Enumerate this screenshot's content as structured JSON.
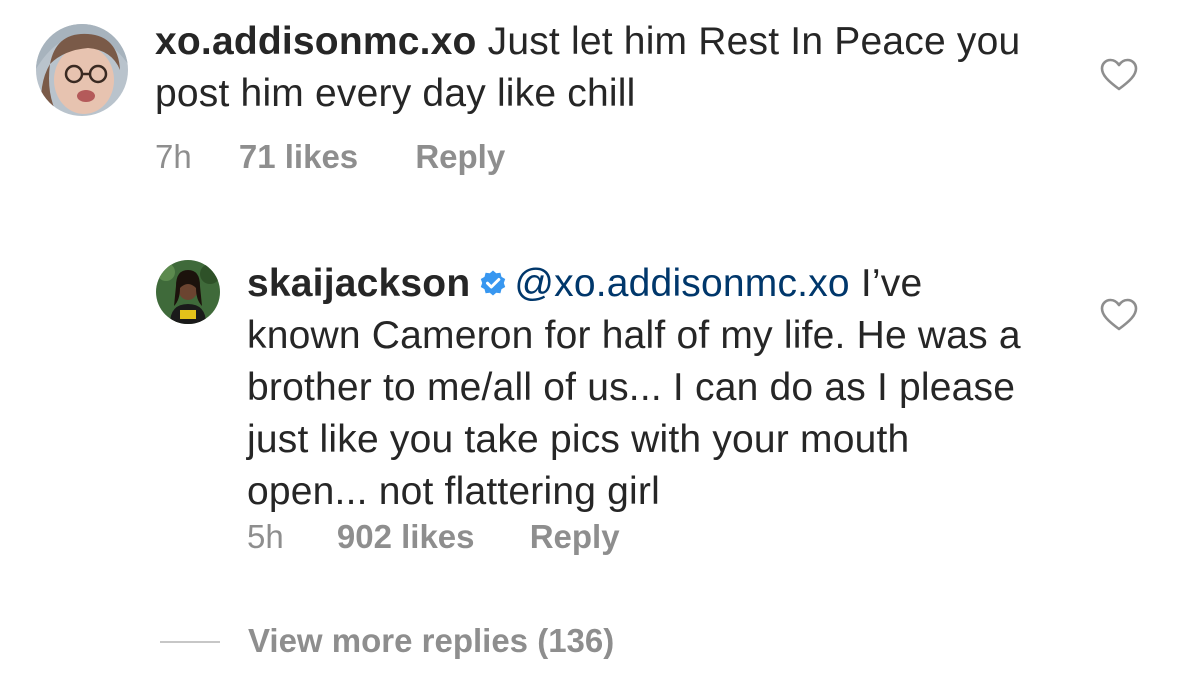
{
  "comment": {
    "username": "xo.addisonmc.xo",
    "text": " Just let him Rest In Peace you post him every day like chill",
    "time": "7h",
    "likes": "71 likes",
    "reply_label": "Reply"
  },
  "reply": {
    "username": "skaijackson",
    "verified": true,
    "mention": "@xo.addisonmc.xo",
    "text": " I’ve known Cameron for half of my life. He was a brother to me/all of us... I can do as I please just like you take pics with your mouth open... not flattering girl",
    "time": "5h",
    "likes": "902 likes",
    "reply_label": "Reply"
  },
  "view_more": "View more replies (136)",
  "icons": {
    "like": "heart-outline-icon",
    "verified": "verified-badge-icon"
  },
  "colors": {
    "text": "#262626",
    "secondary": "#8e8e8e",
    "mention": "#00376b",
    "verified": "#3897f0"
  }
}
